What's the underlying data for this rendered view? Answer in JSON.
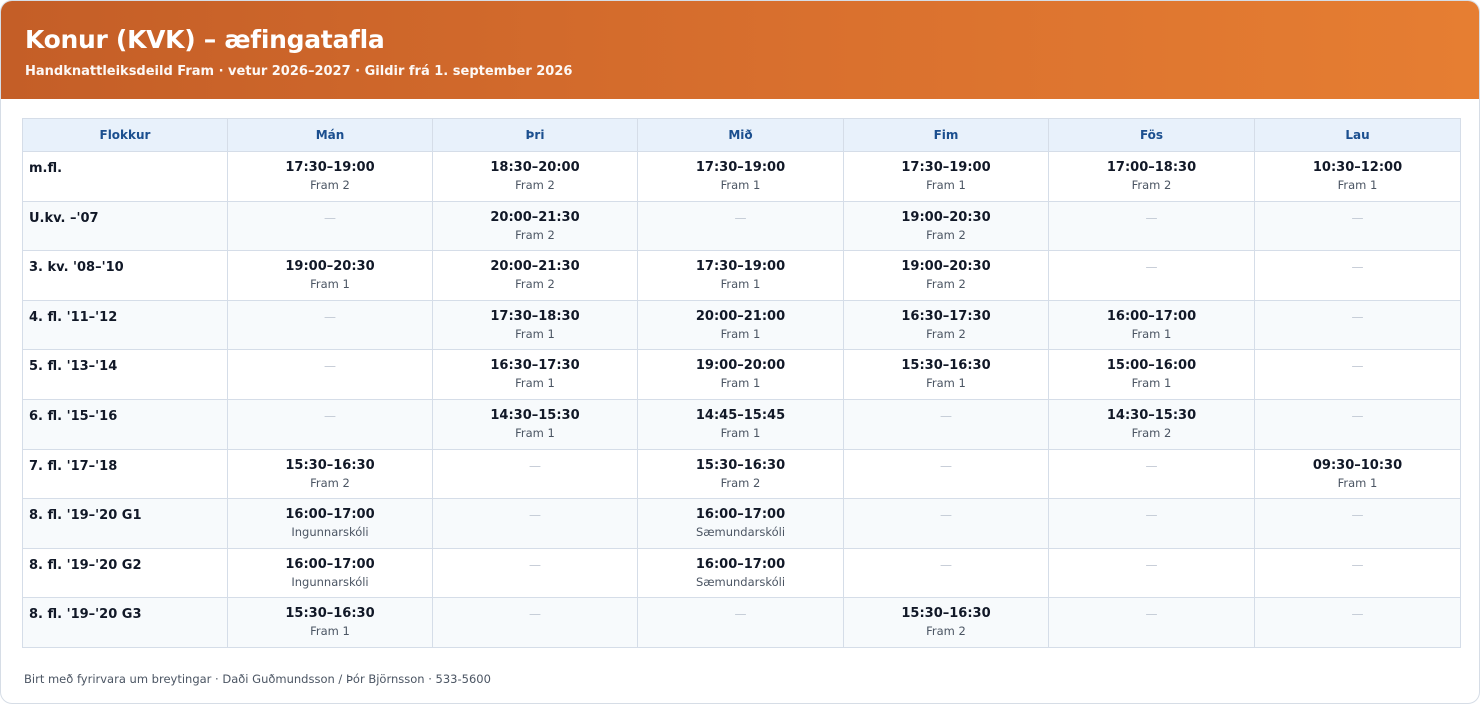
{
  "header": {
    "title": "Konur (KVK) – æfingatafla",
    "subtitle": "Handknattleiksdeild Fram · vetur 2026–2027 · Gildir frá 1. september 2026"
  },
  "table": {
    "columns": [
      "Flokkur",
      "Mán",
      "Þri",
      "Mið",
      "Fim",
      "Fös",
      "Lau"
    ],
    "empty_marker": "—",
    "rows": [
      {
        "group": "m.fl.",
        "cells": [
          {
            "time": "17:30–19:00",
            "place": "Fram 2"
          },
          {
            "time": "18:30–20:00",
            "place": "Fram 2"
          },
          {
            "time": "17:30–19:00",
            "place": "Fram 1"
          },
          {
            "time": "17:30–19:00",
            "place": "Fram 1"
          },
          {
            "time": "17:00–18:30",
            "place": "Fram 2"
          },
          {
            "time": "10:30–12:00",
            "place": "Fram 1"
          }
        ]
      },
      {
        "group": "U.kv. –'07",
        "cells": [
          null,
          {
            "time": "20:00–21:30",
            "place": "Fram 2"
          },
          null,
          {
            "time": "19:00–20:30",
            "place": "Fram 2"
          },
          null,
          null
        ]
      },
      {
        "group": "3. kv. '08–'10",
        "cells": [
          {
            "time": "19:00–20:30",
            "place": "Fram 1"
          },
          {
            "time": "20:00–21:30",
            "place": "Fram 2"
          },
          {
            "time": "17:30–19:00",
            "place": "Fram 1"
          },
          {
            "time": "19:00–20:30",
            "place": "Fram 2"
          },
          null,
          null
        ]
      },
      {
        "group": "4. fl. '11–'12",
        "cells": [
          null,
          {
            "time": "17:30–18:30",
            "place": "Fram 1"
          },
          {
            "time": "20:00–21:00",
            "place": "Fram 1"
          },
          {
            "time": "16:30–17:30",
            "place": "Fram 2"
          },
          {
            "time": "16:00–17:00",
            "place": "Fram 1"
          },
          null
        ]
      },
      {
        "group": "5. fl. '13–'14",
        "cells": [
          null,
          {
            "time": "16:30–17:30",
            "place": "Fram 1"
          },
          {
            "time": "19:00–20:00",
            "place": "Fram 1"
          },
          {
            "time": "15:30–16:30",
            "place": "Fram 1"
          },
          {
            "time": "15:00–16:00",
            "place": "Fram 1"
          },
          null
        ]
      },
      {
        "group": "6. fl. '15–'16",
        "cells": [
          null,
          {
            "time": "14:30–15:30",
            "place": "Fram 1"
          },
          {
            "time": "14:45–15:45",
            "place": "Fram 1"
          },
          null,
          {
            "time": "14:30–15:30",
            "place": "Fram 2"
          },
          null
        ]
      },
      {
        "group": "7. fl. '17–'18",
        "cells": [
          {
            "time": "15:30–16:30",
            "place": "Fram 2"
          },
          null,
          {
            "time": "15:30–16:30",
            "place": "Fram 2"
          },
          null,
          null,
          {
            "time": "09:30–10:30",
            "place": "Fram 1"
          }
        ]
      },
      {
        "group": "8. fl. '19–'20 G1",
        "cells": [
          {
            "time": "16:00–17:00",
            "place": "Ingunnarskóli"
          },
          null,
          {
            "time": "16:00–17:00",
            "place": "Sæmundarskóli"
          },
          null,
          null,
          null
        ]
      },
      {
        "group": "8. fl. '19–'20 G2",
        "cells": [
          {
            "time": "16:00–17:00",
            "place": "Ingunnarskóli"
          },
          null,
          {
            "time": "16:00–17:00",
            "place": "Sæmundarskóli"
          },
          null,
          null,
          null
        ]
      },
      {
        "group": "8. fl. '19–'20 G3",
        "cells": [
          {
            "time": "15:30–16:30",
            "place": "Fram 1"
          },
          null,
          null,
          {
            "time": "15:30–16:30",
            "place": "Fram 2"
          },
          null,
          null
        ]
      }
    ]
  },
  "footer": {
    "text": "Birt með fyrirvara um breytingar · Daði Guðmundsson / Þór Björnsson · 533-5600"
  },
  "colors": {
    "header_gradient_start": "#c45e27",
    "header_gradient_end": "#e67e32",
    "column_header_bg": "#e8f1fb",
    "column_header_text": "#1b4f8f"
  }
}
